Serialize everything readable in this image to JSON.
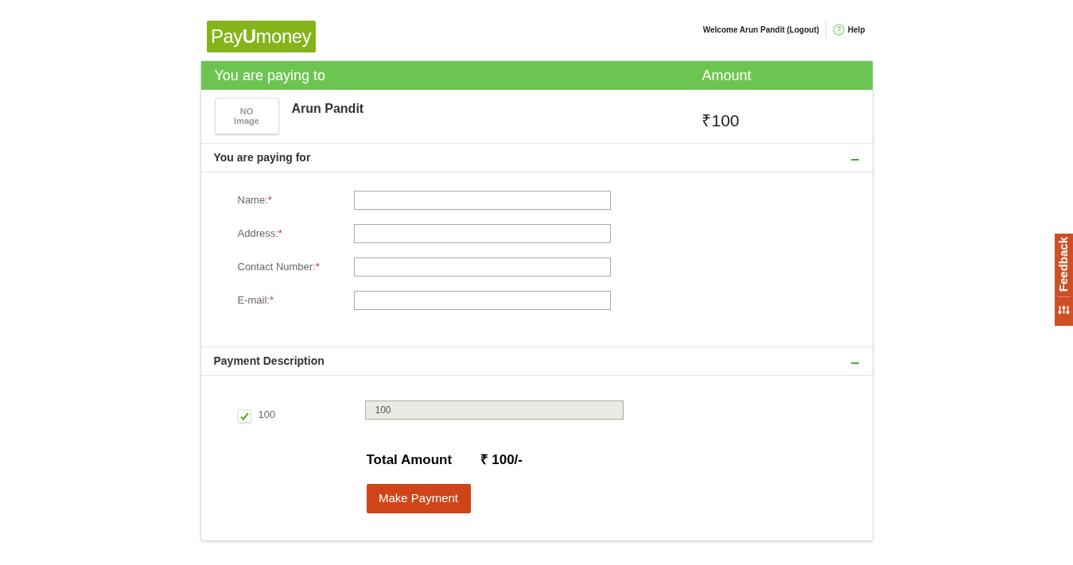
{
  "logo": {
    "text": "Pay**U**money"
  },
  "header": {
    "welcome": "Welcome Arun Pandit (Logout)",
    "help": "Help"
  },
  "payee_bar": {
    "left": "You are paying to",
    "right": "Amount"
  },
  "payee": {
    "image_text": "NO Image",
    "name": "Arun Pandit",
    "amount": "₹100"
  },
  "sections": [
    {
      "kind": "form",
      "title": "You are paying for",
      "expanded": true,
      "collapse_icon": "–",
      "fields": [
        {
          "label": "Name:",
          "required_mark": "*"
        },
        {
          "label": "Address:",
          "required_mark": "*"
        },
        {
          "label": "Contact Number:",
          "required_mark": "*"
        },
        {
          "label": "E-mail:",
          "required_mark": "*"
        }
      ]
    },
    {
      "kind": "payment",
      "title": "Payment Description",
      "expanded": true,
      "collapse_icon": "–",
      "items": [
        {
          "label": "100",
          "checked": true,
          "value": "100"
        }
      ],
      "total_label": "Total Amount",
      "total_value": "₹ 100/-",
      "button": "Make Payment"
    }
  ],
  "feedback": {
    "label": "Feedback"
  }
}
